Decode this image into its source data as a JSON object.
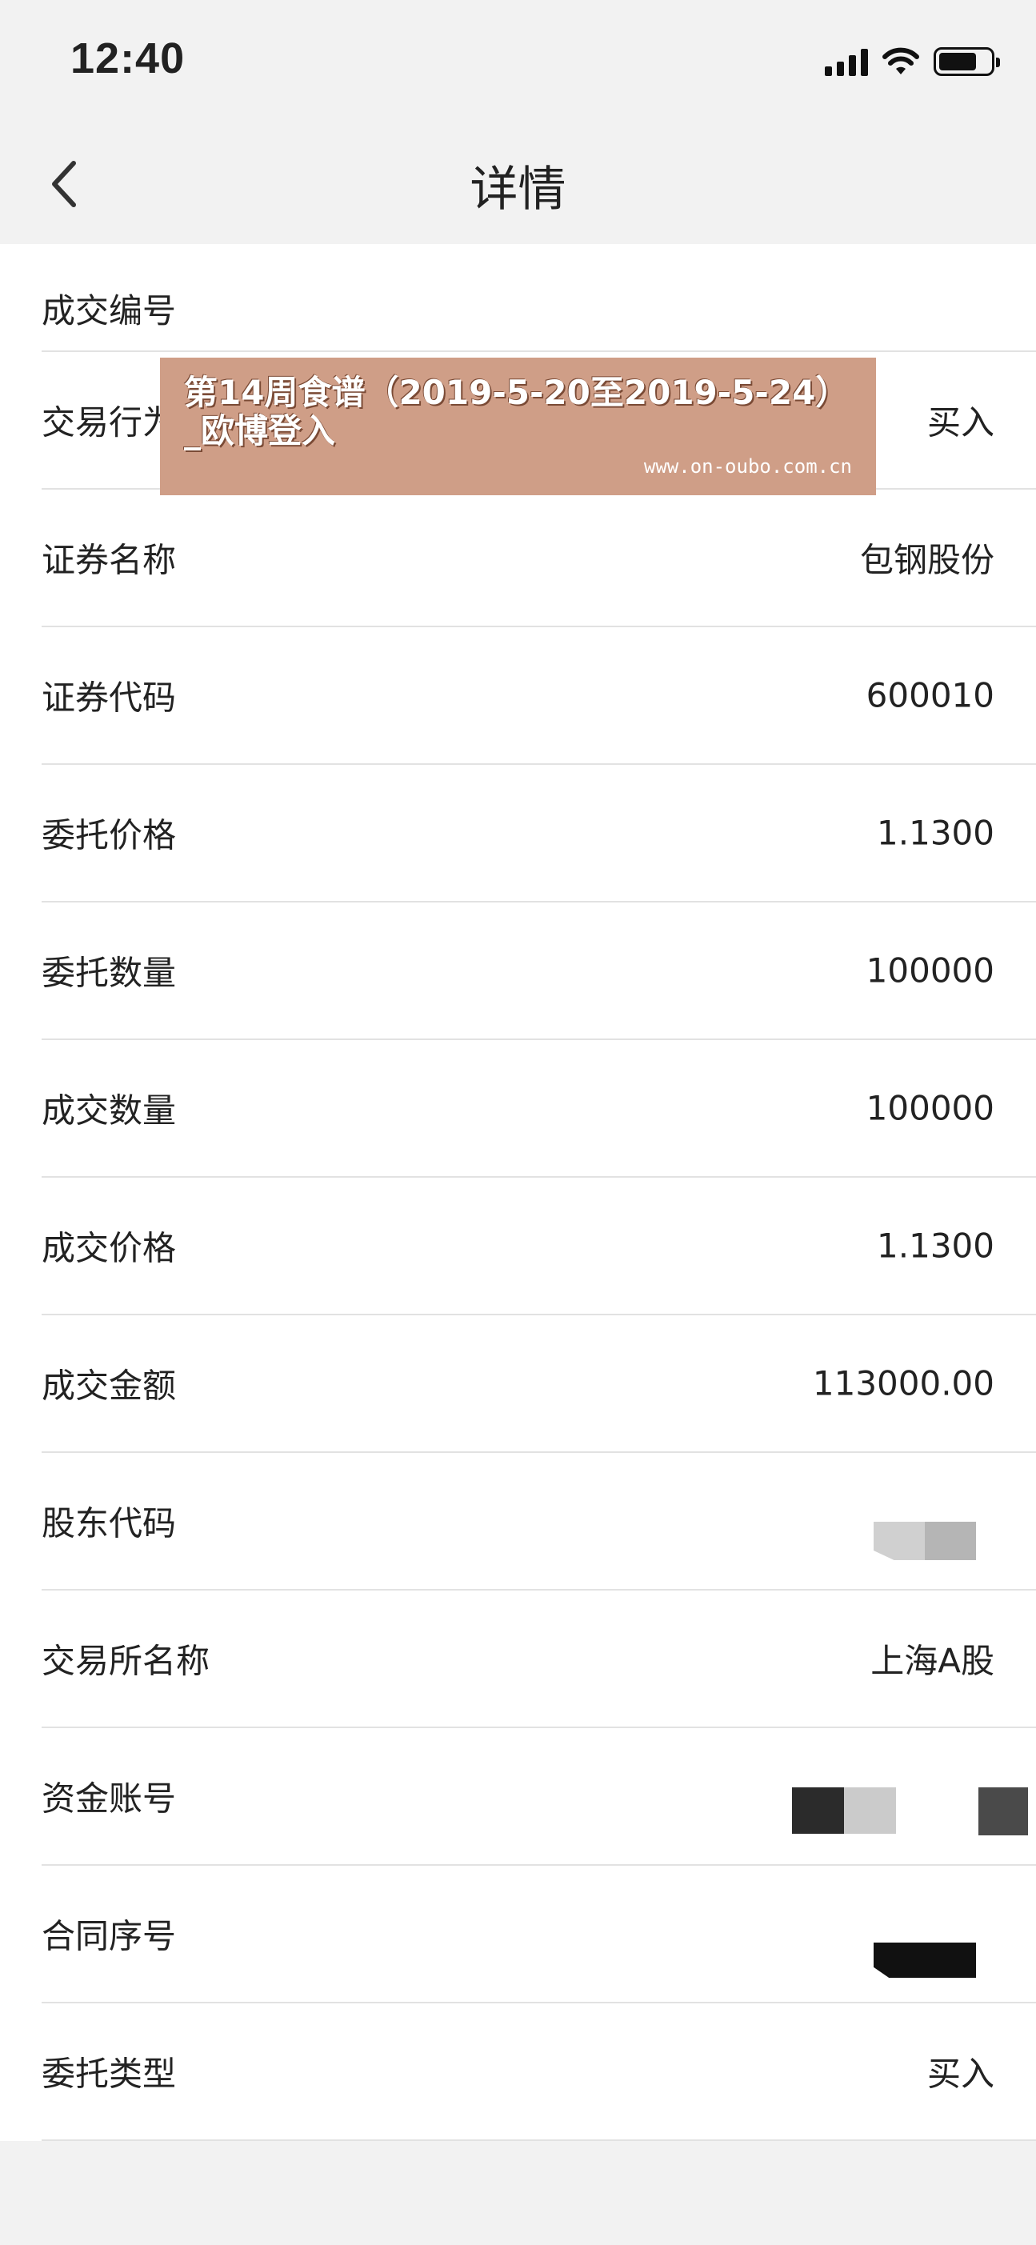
{
  "status": {
    "time": "12:40"
  },
  "nav": {
    "title": "详情"
  },
  "rows": [
    {
      "label": "成交编号",
      "value": ""
    },
    {
      "label": "交易行为",
      "value": "买入"
    },
    {
      "label": "证券名称",
      "value": "包钢股份"
    },
    {
      "label": "证券代码",
      "value": "600010"
    },
    {
      "label": "委托价格",
      "value": "1.1300"
    },
    {
      "label": "委托数量",
      "value": "100000"
    },
    {
      "label": "成交数量",
      "value": "100000"
    },
    {
      "label": "成交价格",
      "value": "1.1300"
    },
    {
      "label": "成交金额",
      "value": "113000.00"
    },
    {
      "label": "股东代码",
      "value": ""
    },
    {
      "label": "交易所名称",
      "value": "上海A股"
    },
    {
      "label": "资金账号",
      "value": ""
    },
    {
      "label": "合同序号",
      "value": ""
    },
    {
      "label": "委托类型",
      "value": "买入"
    }
  ],
  "watermark": {
    "title": "第14周食谱（2019-5-20至2019-5-24）_欧博登入",
    "url": "www.on-oubo.com.cn"
  },
  "colors": {
    "watermark_bg": "#cf9e87",
    "page_bg": "#f2f2f2"
  }
}
